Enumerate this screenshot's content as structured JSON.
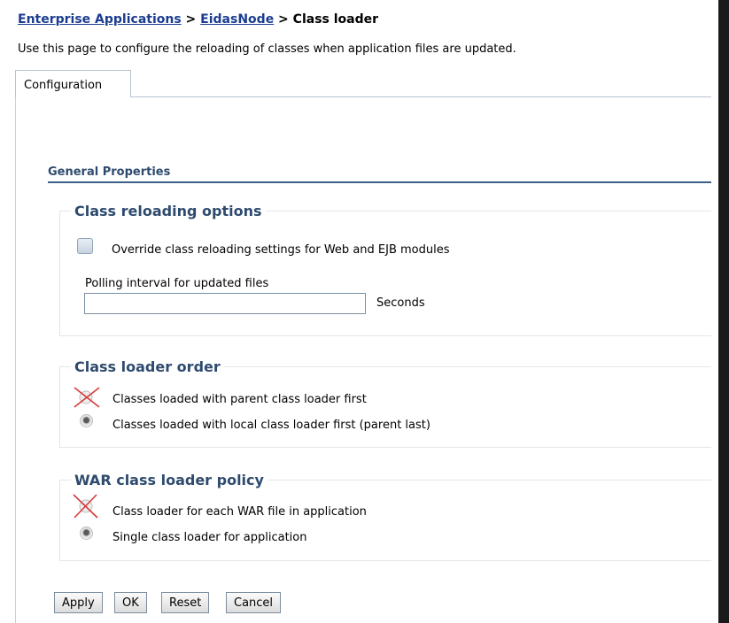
{
  "breadcrumb": {
    "link1": "Enterprise Applications",
    "sep1": " > ",
    "link2": "EidasNode",
    "sep2": " > ",
    "current": "Class loader"
  },
  "page_description": "Use this page to configure the reloading of classes when application files are updated.",
  "tabs": [
    {
      "label": "Configuration",
      "selected": true
    }
  ],
  "general_properties": {
    "title": "General Properties"
  },
  "class_reloading": {
    "legend": "Class reloading options",
    "override_label": "Override class reloading settings for Web and EJB modules",
    "override_checked": false,
    "polling_label": "Polling interval for updated files",
    "polling_value": "",
    "units": "Seconds"
  },
  "class_loader_order": {
    "legend": "Class loader order",
    "options": [
      {
        "label": "Classes loaded with parent class loader first",
        "selected": false,
        "crossed_out": true
      },
      {
        "label": "Classes loaded with local class loader first (parent last)",
        "selected": true,
        "crossed_out": false
      }
    ]
  },
  "war_policy": {
    "legend": "WAR class loader policy",
    "options": [
      {
        "label": "Class loader for each WAR file in application",
        "selected": false,
        "crossed_out": true
      },
      {
        "label": "Single class loader for application",
        "selected": true,
        "crossed_out": false
      }
    ]
  },
  "buttons": {
    "apply": "Apply",
    "ok": "OK",
    "reset": "Reset",
    "cancel": "Cancel"
  },
  "colors": {
    "link": "#1b3d8f",
    "section_title": "#2e4b6e",
    "rule": "#3c5f86",
    "cross_mark": "#d43a3a"
  }
}
